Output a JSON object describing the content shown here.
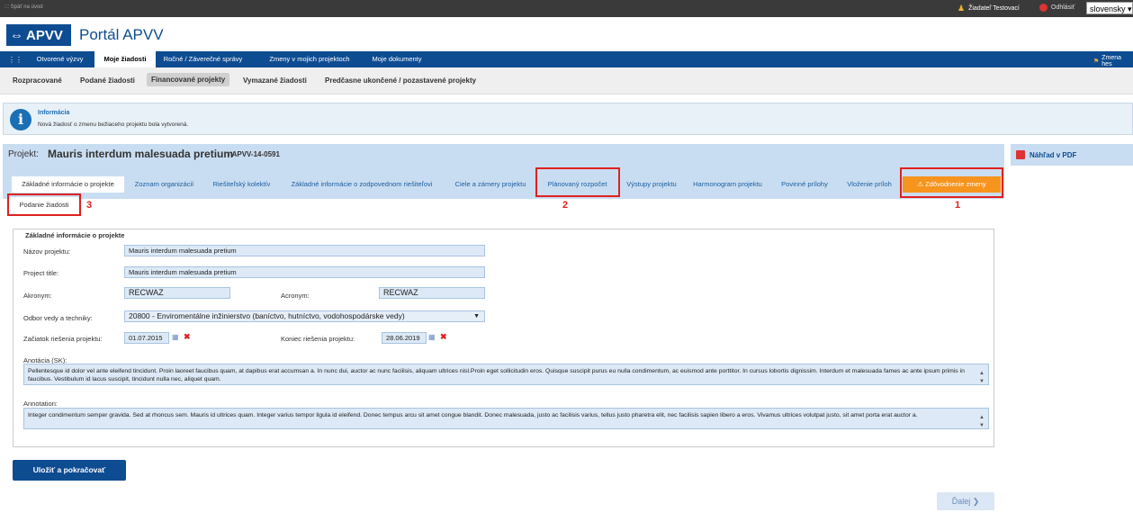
{
  "topbar": {
    "back_label": "::: Späť na úvod",
    "user_label": "Žiadateľ Testovací",
    "logout_label": "Odhlásiť",
    "language_value": "slovensky ▾"
  },
  "header": {
    "logo_text": "APVV",
    "portal_title": "Portál APVV"
  },
  "main_nav": {
    "items": [
      {
        "label": "Otvorené výzvy"
      },
      {
        "label": "Moje žiadosti"
      },
      {
        "label": "Ročné / Záverečné správy"
      },
      {
        "label": "Zmeny v mojich projektoch"
      },
      {
        "label": "Moje dokumenty"
      }
    ],
    "right_label": "Zmena hes"
  },
  "sub_nav": {
    "items": [
      {
        "label": "Rozpracované"
      },
      {
        "label": "Podané žiadosti"
      },
      {
        "label": "Financované projekty"
      },
      {
        "label": "Vymazané žiadosti"
      },
      {
        "label": "Predčasne ukončené / pozastavené projekty"
      }
    ]
  },
  "info": {
    "title": "Informácia",
    "message": "Nová žiadosť o zmenu bežiaceho projektu bola vytvorená."
  },
  "project": {
    "label": "Projekt:",
    "name": "Mauris interdum malesuada pretium",
    "code": "- APVV-14-0591"
  },
  "pdf_label": "Náhľad v PDF",
  "tabs": [
    {
      "label": "Základné informácie o projekte"
    },
    {
      "label": "Zoznam organizácií"
    },
    {
      "label": "Riešiteľský kolektív"
    },
    {
      "label": "Základné informácie o zodpovednom riešiteľovi"
    },
    {
      "label": "Ciele a zámery projektu"
    },
    {
      "label": "Plánovaný rozpočet"
    },
    {
      "label": "Výstupy projektu"
    },
    {
      "label": "Harmonogram projektu"
    },
    {
      "label": "Povinné prílohy"
    },
    {
      "label": "Vloženie príloh"
    },
    {
      "label": "Zdôvodnenie zmeny"
    },
    {
      "label": "Podanie žiadosti"
    }
  ],
  "annotations": [
    "1",
    "2",
    "3"
  ],
  "form": {
    "legend": "Základné informácie o projekte",
    "nazov_label": "Názov projektu:",
    "nazov_value": "Mauris interdum malesuada pretium",
    "title_label": "Project title:",
    "title_value": "Mauris interdum malesuada pretium",
    "akronym_label": "Akronym:",
    "akronym_value": "RECWAZ",
    "acronym_label": "Acronym:",
    "acronym_value": "RECWAZ",
    "odbor_label": "Odbor vedy a techniky:",
    "odbor_value": "20800 - Enviromentálne inžinierstvo (baníctvo, hutníctvo, vodohospodárske vedy)",
    "zaciatok_label": "Začiatok riešenia projektu:",
    "zaciatok_value": "01.07.2015",
    "koniec_label": "Koniec riešenia projektu:",
    "koniec_value": "28.06.2019",
    "anotacia_label": "Anotácia (SK):",
    "anotacia_value": "Pellentesque id dolor vel ante eleifend tincidunt. Proin laoreet faucibus quam, at dapibus erat accumsan a. In nunc dui, auctor ac nunc facilisis, aliquam ultrices nisl.Proin eget sollicitudin eros. Quisque suscipit purus eu nulla condimentum, ac euismod ante porttitor. In cursus lobortis dignissim. Interdum et malesuada fames ac ante ipsum primis in faucibus. Vestibulum id lacus suscipit, tincidunt nulla nec, aliquet quam.",
    "annotation_label": "Annotation:",
    "annotation_value": "Integer condimentum semper gravida. Sed at rhoncus sem. Mauris id ultrices quam. Integer varius tempor ligula id eleifend. Donec tempus arcu sit amet congue blandit. Donec malesuada, justo ac facilisis varius, tellus justo pharetra elit, nec facilisis sapien libero a eros. Vivamus ultrices volutpat justo, sit amet porta erat auctor a."
  },
  "buttons": {
    "save": "Uložiť a pokračovať",
    "next": "Ďalej ❯"
  },
  "colors": {
    "brand": "#0e4c92",
    "warn_tab": "#f7941d",
    "annotation_red": "#e02020"
  }
}
